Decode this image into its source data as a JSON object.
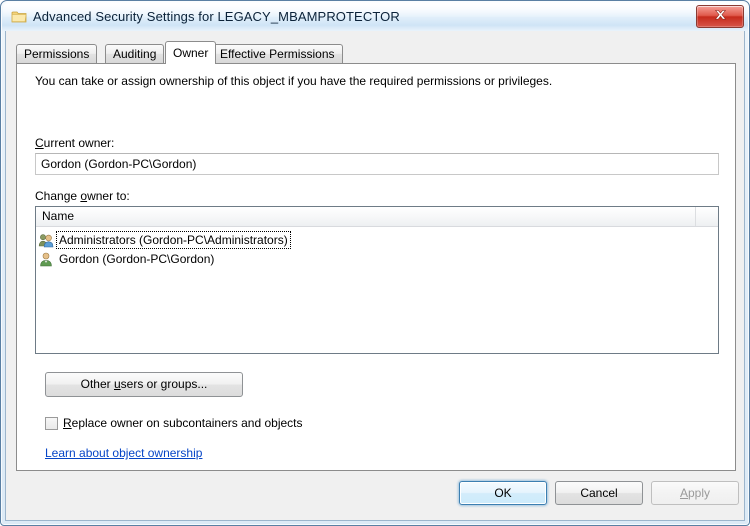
{
  "window": {
    "title": "Advanced Security Settings for LEGACY_MBAMPROTECTOR",
    "icon": "folder-icon",
    "close_label": "X",
    "accent_blue": "#3c7fb1",
    "close_red": "#c62a1c",
    "link_blue": "#0645c7"
  },
  "tabs": [
    {
      "label": "Permissions",
      "active": false
    },
    {
      "label": "Auditing",
      "active": false
    },
    {
      "label": "Owner",
      "active": true
    },
    {
      "label": "Effective Permissions",
      "active": false
    }
  ],
  "owner_page": {
    "description": "You can take or assign ownership of this object if you have the required permissions or privileges.",
    "current_owner_label_before": "C",
    "current_owner_label_after": "urrent owner:",
    "current_owner_value": "Gordon (Gordon-PC\\Gordon)",
    "change_owner_label_before": "Change ",
    "change_owner_label_accel": "o",
    "change_owner_label_after": "wner to:",
    "list": {
      "column_header": "Name",
      "rows": [
        {
          "label": "Administrators (Gordon-PC\\Administrators)",
          "icon": "group-users-icon",
          "focused": true
        },
        {
          "label": "Gordon (Gordon-PC\\Gordon)",
          "icon": "single-user-icon",
          "focused": false
        }
      ]
    },
    "other_users_button": {
      "text_before": "Other ",
      "text_accel": "u",
      "text_after": "sers or groups..."
    },
    "replace_owner_checkbox": {
      "checked": false,
      "text_accel": "R",
      "text_after": "eplace owner on subcontainers and objects"
    },
    "help_link": "Learn about object ownership"
  },
  "footer": {
    "ok_label": "OK",
    "cancel_label": "Cancel",
    "apply_accel": "A",
    "apply_after": "pply",
    "apply_disabled": true
  }
}
